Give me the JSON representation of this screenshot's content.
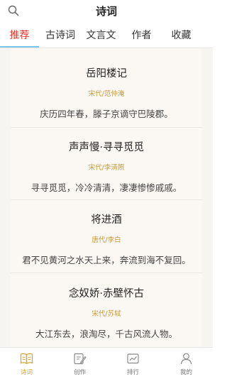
{
  "header": {
    "title": "诗词",
    "search_icon": "search-icon"
  },
  "tabs": [
    {
      "label": "推荐",
      "active": true
    },
    {
      "label": "古诗词",
      "active": false
    },
    {
      "label": "文言文",
      "active": false
    },
    {
      "label": "作者",
      "active": false
    },
    {
      "label": "收藏",
      "active": false
    }
  ],
  "poems": [
    {
      "title": "岳阳楼记",
      "meta": "宋代/范仲淹",
      "line": "庆历四年春，滕子京谪守巴陵郡。"
    },
    {
      "title": "声声慢·寻寻觅觅",
      "meta": "宋代/李清照",
      "line": "寻寻觅觅，冷冷清清，凄凄惨惨戚戚。"
    },
    {
      "title": "将进酒",
      "meta": "唐代/李白",
      "line": "君不见黄河之水天上来，奔流到海不复回。"
    },
    {
      "title": "念奴娇·赤壁怀古",
      "meta": "宋代/苏轼",
      "line": "大江东去，浪淘尽，千古风流人物。"
    }
  ],
  "bottom_nav": [
    {
      "label": "诗词",
      "icon": "book-icon",
      "active": true
    },
    {
      "label": "创作",
      "icon": "edit-icon",
      "active": false
    },
    {
      "label": "排行",
      "icon": "ranking-icon",
      "active": false
    },
    {
      "label": "我的",
      "icon": "person-icon",
      "active": false
    }
  ],
  "colors": {
    "active_tab": "#e6332a",
    "tab_underline": "#7ec4e6",
    "meta_text": "#c49a3c",
    "nav_active": "#d4a93a",
    "content_bg": "#fbf8f3"
  }
}
